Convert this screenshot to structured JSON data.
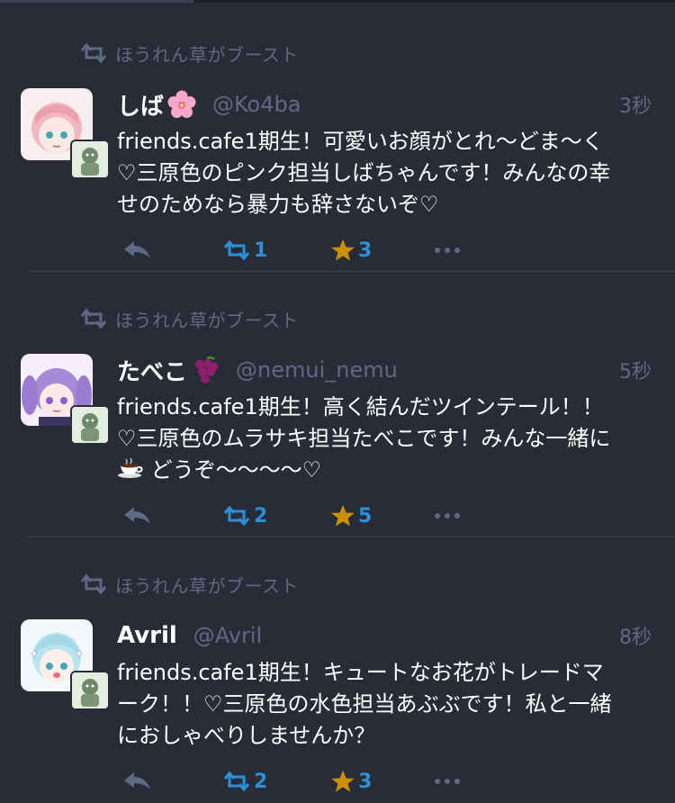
{
  "statuses": [
    {
      "boost_text": "ほうれん草がブースト",
      "display_name": "しば",
      "name_emoji": "cherry-blossom",
      "acct": "@Ko4ba",
      "time": "3秒",
      "content_lines": [
        "friends.cafe1期生！可愛いお顔がとれ〜どま〜く",
        "♡三原色のピンク担当しばちゃんです！みんなの幸",
        "せのためなら暴力も辞さないぞ♡"
      ],
      "boosts": "1",
      "favourites": "3",
      "avatar_hair": "#f2b8c0"
    },
    {
      "boost_text": "ほうれん草がブースト",
      "display_name": "たべこ",
      "name_emoji": "grapes",
      "acct": "@nemui_nemu",
      "time": "5秒",
      "content_lines": [
        "friends.cafe1期生！高く結んだツインテール！！",
        "♡三原色のムラサキ担当たべこです！みんな一緒に",
        "どうぞ〜〜〜〜♡"
      ],
      "boosts": "2",
      "favourites": "5",
      "avatar_hair": "#a68ad8"
    },
    {
      "boost_text": "ほうれん草がブースト",
      "display_name": "Avril",
      "name_emoji": "",
      "acct": "@Avril",
      "time": "8秒",
      "content_lines": [
        "friends.cafe1期生！キュートなお花がトレードマ",
        "ーク！！♡三原色の水色担当あぶぶです！私と一緒",
        "におしゃべりしませんか？"
      ],
      "boosts": "2",
      "favourites": "3",
      "avatar_hair": "#b8e4ee"
    }
  ],
  "colors": {
    "background": "#282c37",
    "muted": "#606984",
    "accent_blue": "#2b90d9",
    "star": "#ca8f04"
  }
}
